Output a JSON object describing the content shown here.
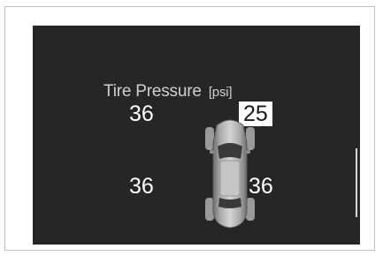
{
  "display": {
    "title": "Tire Pressure",
    "unit": "[psi]"
  },
  "tires": {
    "front_left": "36",
    "front_right": "25",
    "rear_left": "36",
    "rear_right": "36"
  },
  "colors": {
    "screen_bg": "#262626",
    "text": "#ffffff",
    "low_pressure_highlight": "#ffffff"
  },
  "icons": {
    "vehicle": "car-top-view-icon"
  }
}
